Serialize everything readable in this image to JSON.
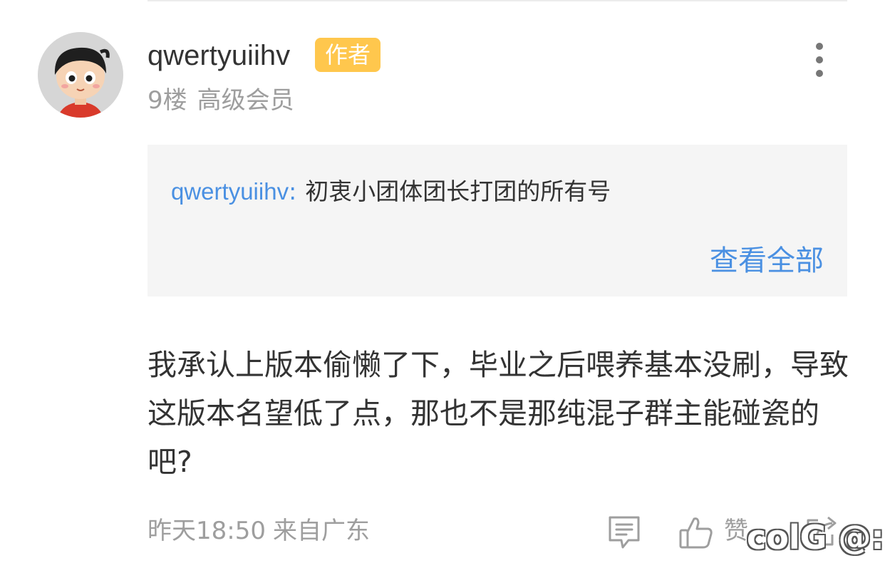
{
  "comment": {
    "username": "qwertyuiihv",
    "author_badge": "作者",
    "floor": "9楼",
    "member_level": "高级会员",
    "quote": {
      "user": "qwertyuiihv",
      "colon": ":",
      "text": "初衷小团体团长打团的所有号",
      "view_all": "查看全部"
    },
    "body": "我承认上版本偷懒了下，毕业之后喂养基本没刷，导致这版本名望低了点，那也不是那纯混子群主能碰瓷的吧?",
    "time": "昨天18:50",
    "location": "来自广东",
    "like_label": "赞"
  },
  "watermark": "colG @:",
  "icons": {
    "avatar": "cartoon-boy-avatar",
    "more": "vertical-dots-icon",
    "reply": "comment-icon",
    "like": "thumbs-up-icon",
    "share": "share-icon"
  },
  "colors": {
    "link_blue": "#4a90e2",
    "badge_yellow": "#ffc74d",
    "meta_gray": "#9e9e9e",
    "quote_bg": "#f5f5f5"
  }
}
